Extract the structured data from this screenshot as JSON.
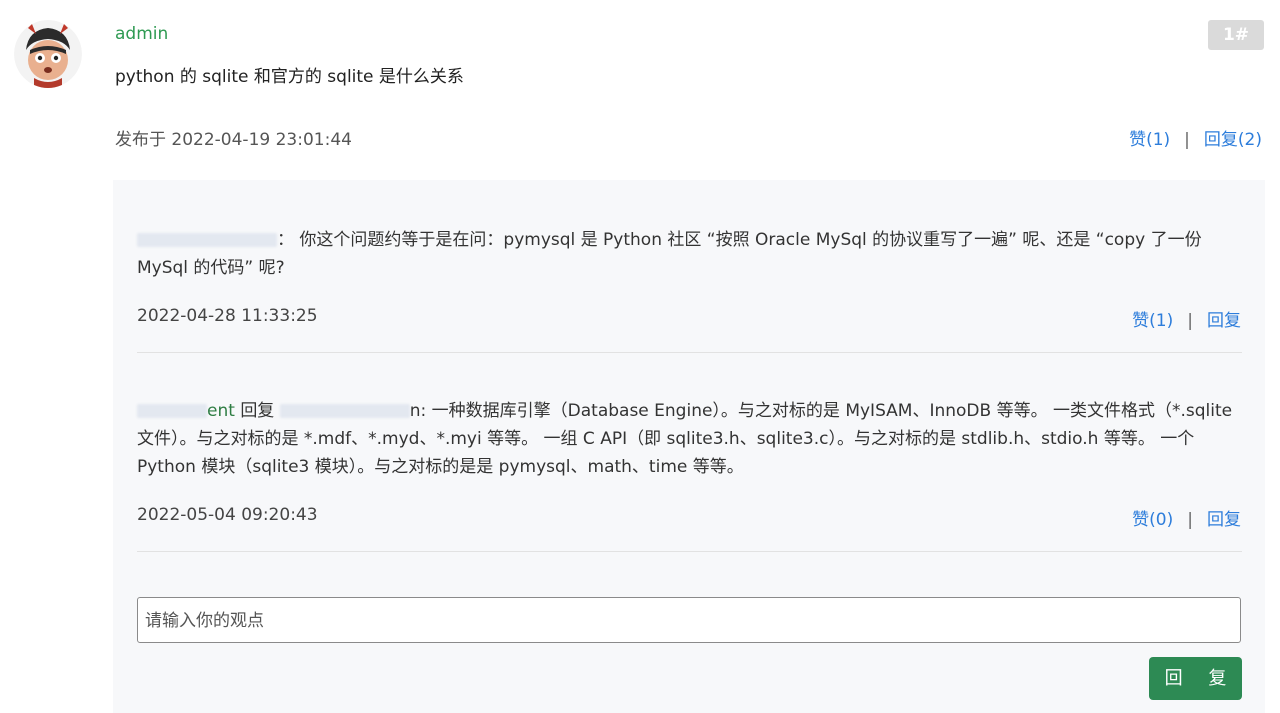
{
  "post": {
    "author": "admin",
    "floor": "1#",
    "question": "python 的 sqlite 和官方的 sqlite 是什么关系",
    "published": "发布于 2022-04-19 23:01:44",
    "like": "赞(1)",
    "separator": "|",
    "reply": "回复(2)"
  },
  "comments": [
    {
      "text": "你这个问题约等于是在问：pymysql 是 Python 社区 “按照 Oracle MySql 的协议重写了一遍” 呢、还是 “copy 了一份 MySql 的代码” 呢?",
      "date": "2022-04-28 11:33:25",
      "like": "赞(1)",
      "separator": "|",
      "reply": "回复"
    },
    {
      "name_suffix": "ent",
      "reply_word": "回复",
      "target_suffix": "n:",
      "text": "一种数据库引擎（Database Engine）。与之对标的是 MyISAM、InnoDB 等等。 一类文件格式（*.sqlite 文件）。与之对标的是 *.mdf、*.myd、*.myi 等等。 一组 C API（即 sqlite3.h、sqlite3.c）。与之对标的是 stdlib.h、stdio.h 等等。 一个 Python 模块（sqlite3 模块）。与之对标的是是 pymysql、math、time 等等。",
      "date": "2022-05-04 09:20:43",
      "like": "赞(0)",
      "separator": "|",
      "reply": "回复"
    }
  ],
  "input": {
    "placeholder": "请输入你的观点"
  },
  "submit_label": "回 复"
}
